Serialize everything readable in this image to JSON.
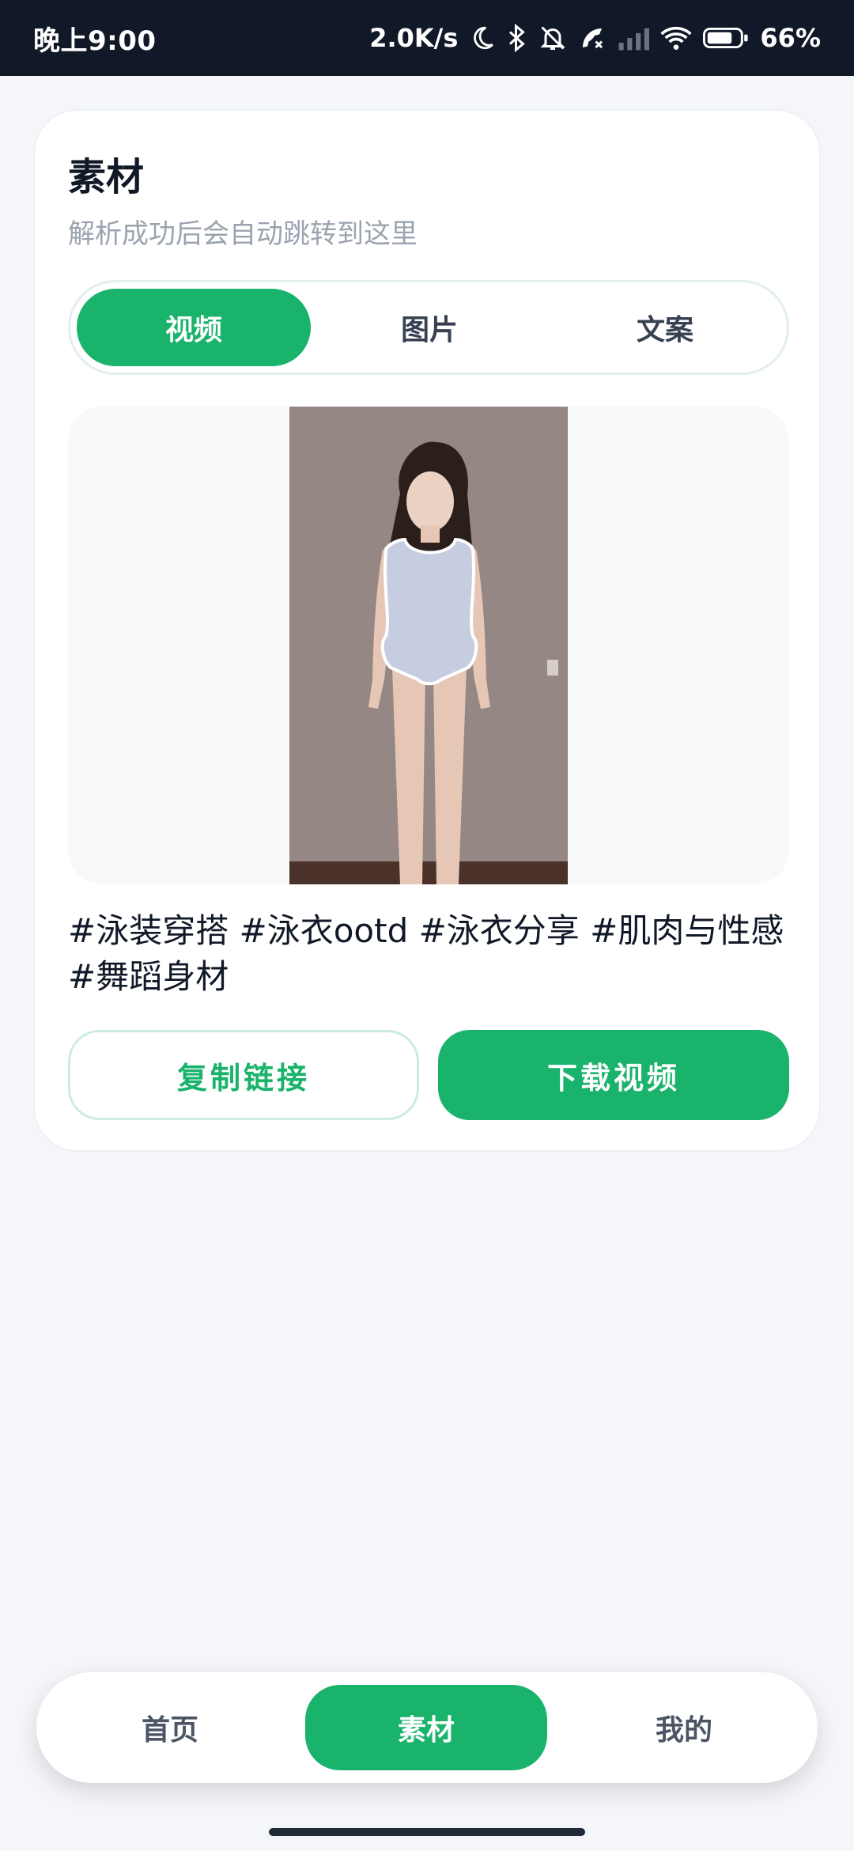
{
  "status_bar": {
    "time": "晚上9:00",
    "network_speed": "2.0K/s",
    "battery": "66%",
    "icons": [
      "moon-icon",
      "bluetooth-icon",
      "mute-bell-icon",
      "call-icon",
      "cell-signal-icon",
      "wifi-icon",
      "battery-icon"
    ]
  },
  "card": {
    "title": "素材",
    "subtitle": "解析成功后会自动跳转到这里",
    "tabs": [
      {
        "label": "视频",
        "active": true
      },
      {
        "label": "图片",
        "active": false
      },
      {
        "label": "文案",
        "active": false
      }
    ],
    "caption": "#泳装穿搭 #泳衣ootd #泳衣分享 #肌肉与性感 #舞蹈身材",
    "buttons": {
      "copy_link": "复制链接",
      "download_video": "下载视频"
    }
  },
  "bottom_nav": {
    "items": [
      {
        "label": "首页",
        "active": false
      },
      {
        "label": "素材",
        "active": true
      },
      {
        "label": "我的",
        "active": false
      }
    ]
  },
  "colors": {
    "accent": "#19b36b",
    "status_bar_bg": "#111827",
    "page_bg": "#f4f6fa"
  }
}
